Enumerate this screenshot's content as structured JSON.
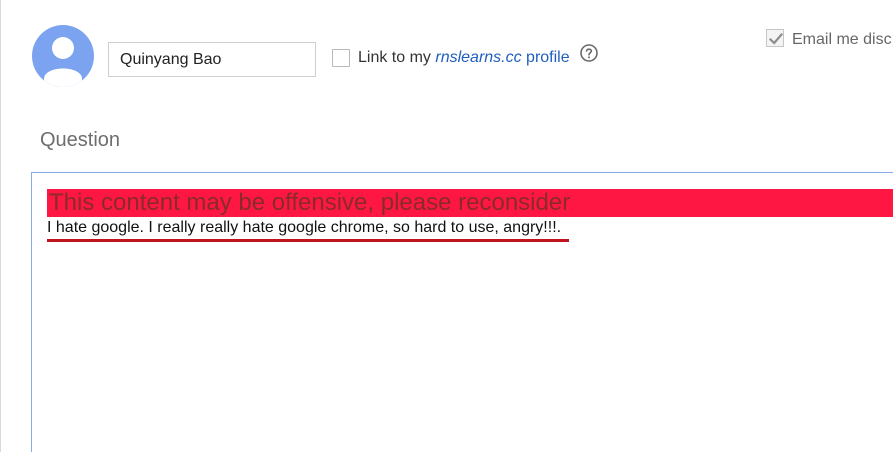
{
  "author": {
    "name_value": "Quinyang Bao",
    "avatar_icon": "default-user-avatar-icon",
    "avatar_color": "#7ba3ef"
  },
  "profile_link": {
    "checked": false,
    "prefix": "Link to my ",
    "site": "rnslearns.cc",
    "suffix": " profile",
    "help_icon": "question-mark-circle-icon"
  },
  "email": {
    "checked": true,
    "label": "Email me disc"
  },
  "question": {
    "heading": "Question",
    "warning": "This content may be offensive, please reconsider",
    "warning_color": "#ff1744",
    "body": "I hate google. I really really hate google chrome, so hard to use, angry!!!.",
    "flag_color": "#c0141f"
  }
}
